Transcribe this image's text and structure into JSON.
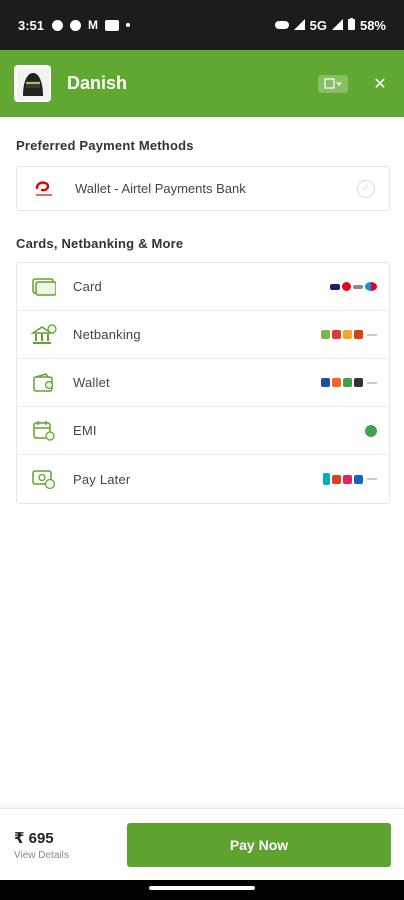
{
  "status_bar": {
    "time": "3:51",
    "network": "5G",
    "battery": "58%"
  },
  "header": {
    "merchant_name": "Danish",
    "avatar_icon": "helmet-avatar-icon",
    "language_icon": "translate-icon",
    "close_glyph": "✕"
  },
  "preferred": {
    "title": "Preferred Payment Methods",
    "method": {
      "label": "Wallet - Airtel Payments Bank",
      "icon": "airtel-logo-icon"
    }
  },
  "more": {
    "title": "Cards, Netbanking & More",
    "methods": [
      {
        "label": "Card",
        "icon": "card-icon"
      },
      {
        "label": "Netbanking",
        "icon": "bank-icon"
      },
      {
        "label": "Wallet",
        "icon": "wallet-icon"
      },
      {
        "label": "EMI",
        "icon": "emi-calendar-icon"
      },
      {
        "label": "Pay Later",
        "icon": "paylater-icon"
      }
    ]
  },
  "footer": {
    "amount": "₹ 695",
    "view_details": "View Details",
    "pay_button": "Pay Now"
  },
  "colors": {
    "brand": "#60a832",
    "button": "#5ea22f"
  }
}
